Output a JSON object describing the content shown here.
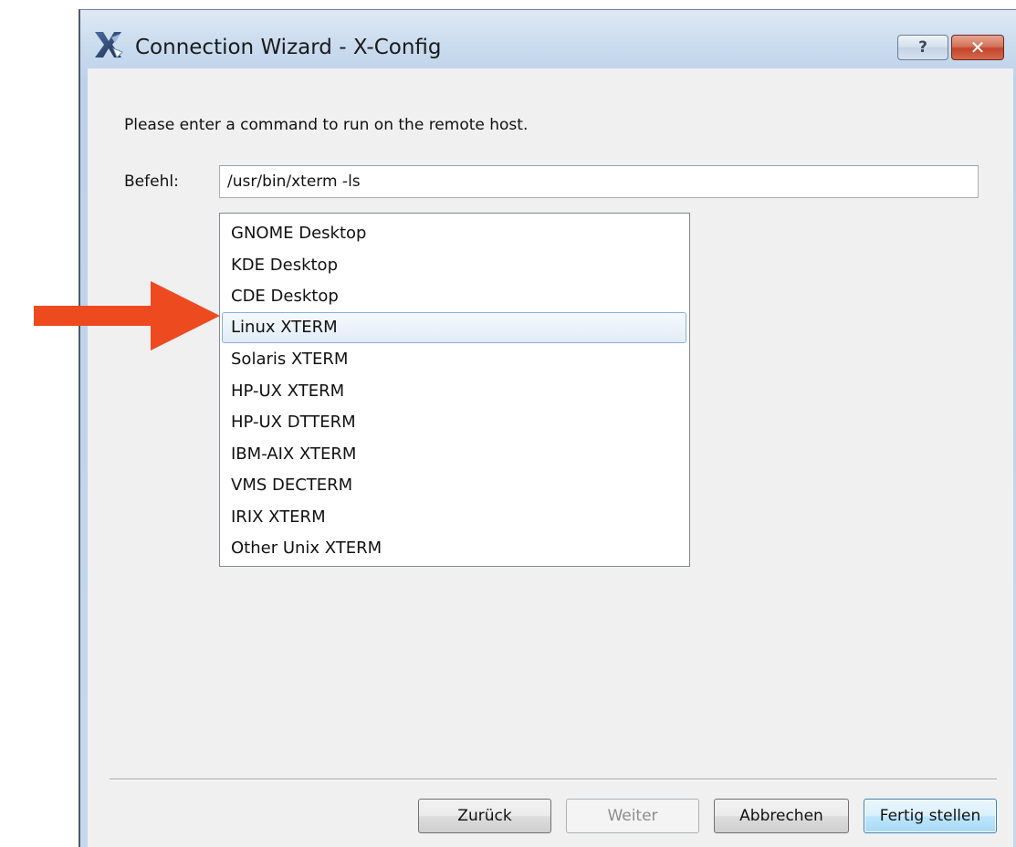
{
  "window": {
    "title": "Connection Wizard - X-Config"
  },
  "titlebar_buttons": {
    "help_glyph": "?",
    "close_glyph": "✕",
    "help_icon": "help-icon",
    "close_icon": "close-icon"
  },
  "content": {
    "instruction": "Please enter a command to run on the remote host.",
    "command_label": "Befehl:",
    "command_value": "/usr/bin/xterm -ls"
  },
  "list": {
    "selected_index": 3,
    "items": [
      "GNOME Desktop",
      "KDE Desktop",
      "CDE Desktop",
      "Linux XTERM",
      "Solaris XTERM",
      "HP-UX XTERM",
      "HP-UX DTTERM",
      "IBM-AIX XTERM",
      "VMS DECTERM",
      "IRIX XTERM",
      "Other Unix XTERM"
    ]
  },
  "buttons": {
    "back": "Zurück",
    "next": "Weiter",
    "cancel": "Abbrechen",
    "finish": "Fertig stellen"
  },
  "colors": {
    "annotation_arrow": "#ee4a1f",
    "selection_border": "#8ab0dc",
    "default_button_border": "#3c7fb1",
    "close_button": "#c2452a"
  }
}
